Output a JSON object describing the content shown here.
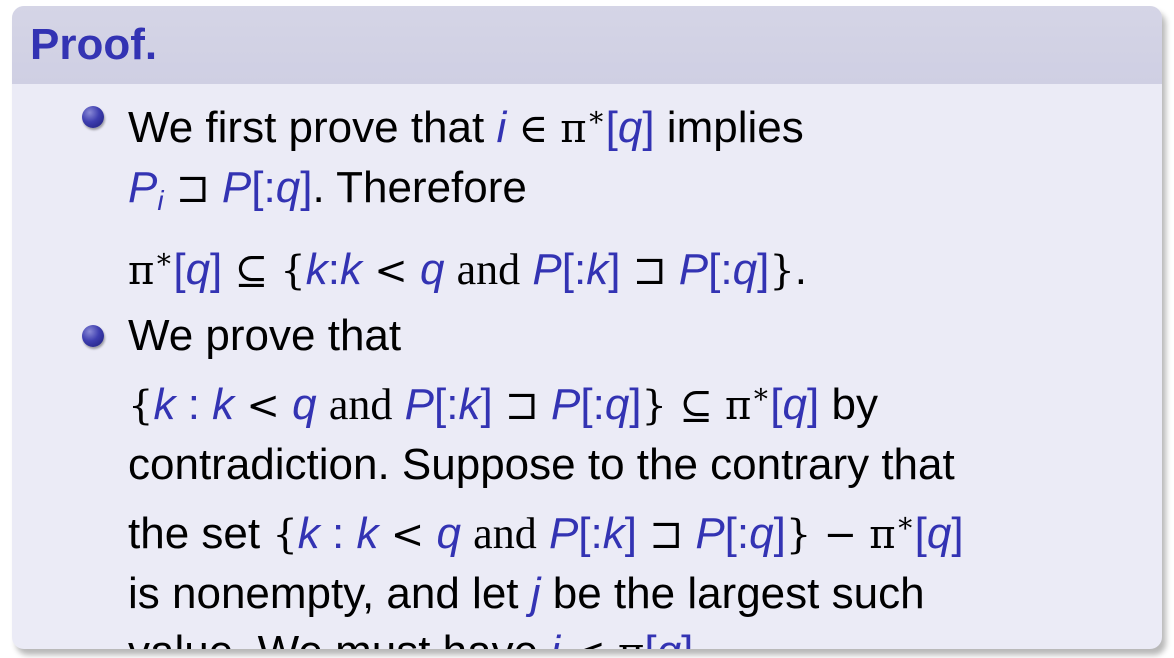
{
  "block": {
    "title": "Proof.",
    "items": [
      {
        "lines": [
          "We first prove that i ∈ π*[q] implies",
          "P_i ⊐ P[:q]. Therefore",
          "π*[q] ⊆ {k:k < q and P[:k] ⊐ P[:q]}."
        ]
      },
      {
        "lines": [
          "We prove that",
          "{k : k < q and P[:k] ⊐ P[:q]} ⊆ π*[q] by",
          "contradiction. Suppose to the contrary that",
          "the set {k : k < q and P[:k] ⊐ P[:q]} − π*[q]",
          "is nonempty, and let j be the largest such",
          "value. We must have j < π[q]."
        ]
      }
    ]
  }
}
